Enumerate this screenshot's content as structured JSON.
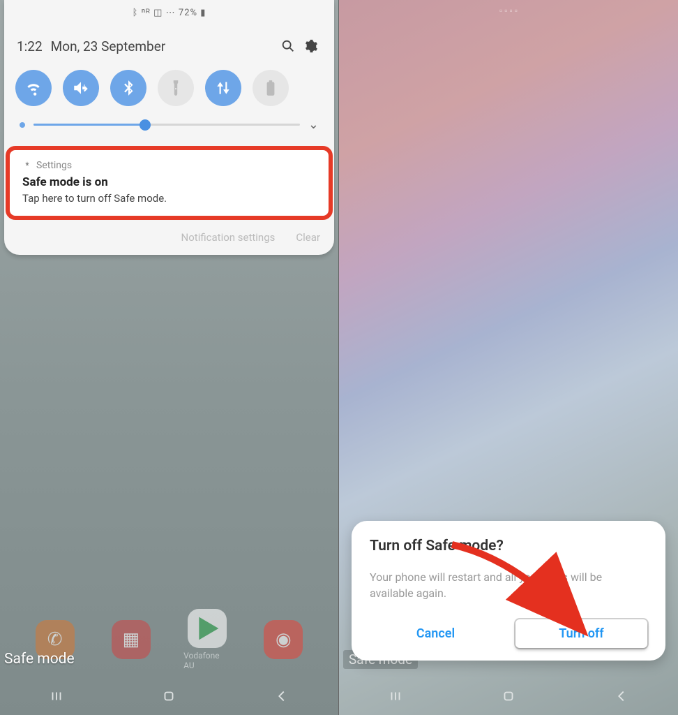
{
  "left": {
    "status_text": "ᛒ ⁿᴿ ◫ ⋯ 72% ▮",
    "time": "1:22",
    "date": "Mon, 23 September",
    "brightness_percent": 42,
    "toggles": {
      "wifi": true,
      "sound_mute": true,
      "bluetooth": true,
      "flashlight": false,
      "mobile_data": true,
      "battery": false
    },
    "notification": {
      "source": "Settings",
      "title": "Safe mode is on",
      "body": "Tap here to turn off Safe mode."
    },
    "footer": {
      "settings_label": "Notification settings",
      "clear_label": "Clear"
    },
    "dock": {
      "carrier": "Vodafone AU"
    },
    "safe_mode_badge": "Safe mode"
  },
  "right": {
    "safe_mode_badge": "Safe mode",
    "dialog": {
      "title": "Turn off Safe mode?",
      "body": "Your phone will restart and all your apps will be available again.",
      "cancel": "Cancel",
      "confirm": "Turn off"
    }
  }
}
